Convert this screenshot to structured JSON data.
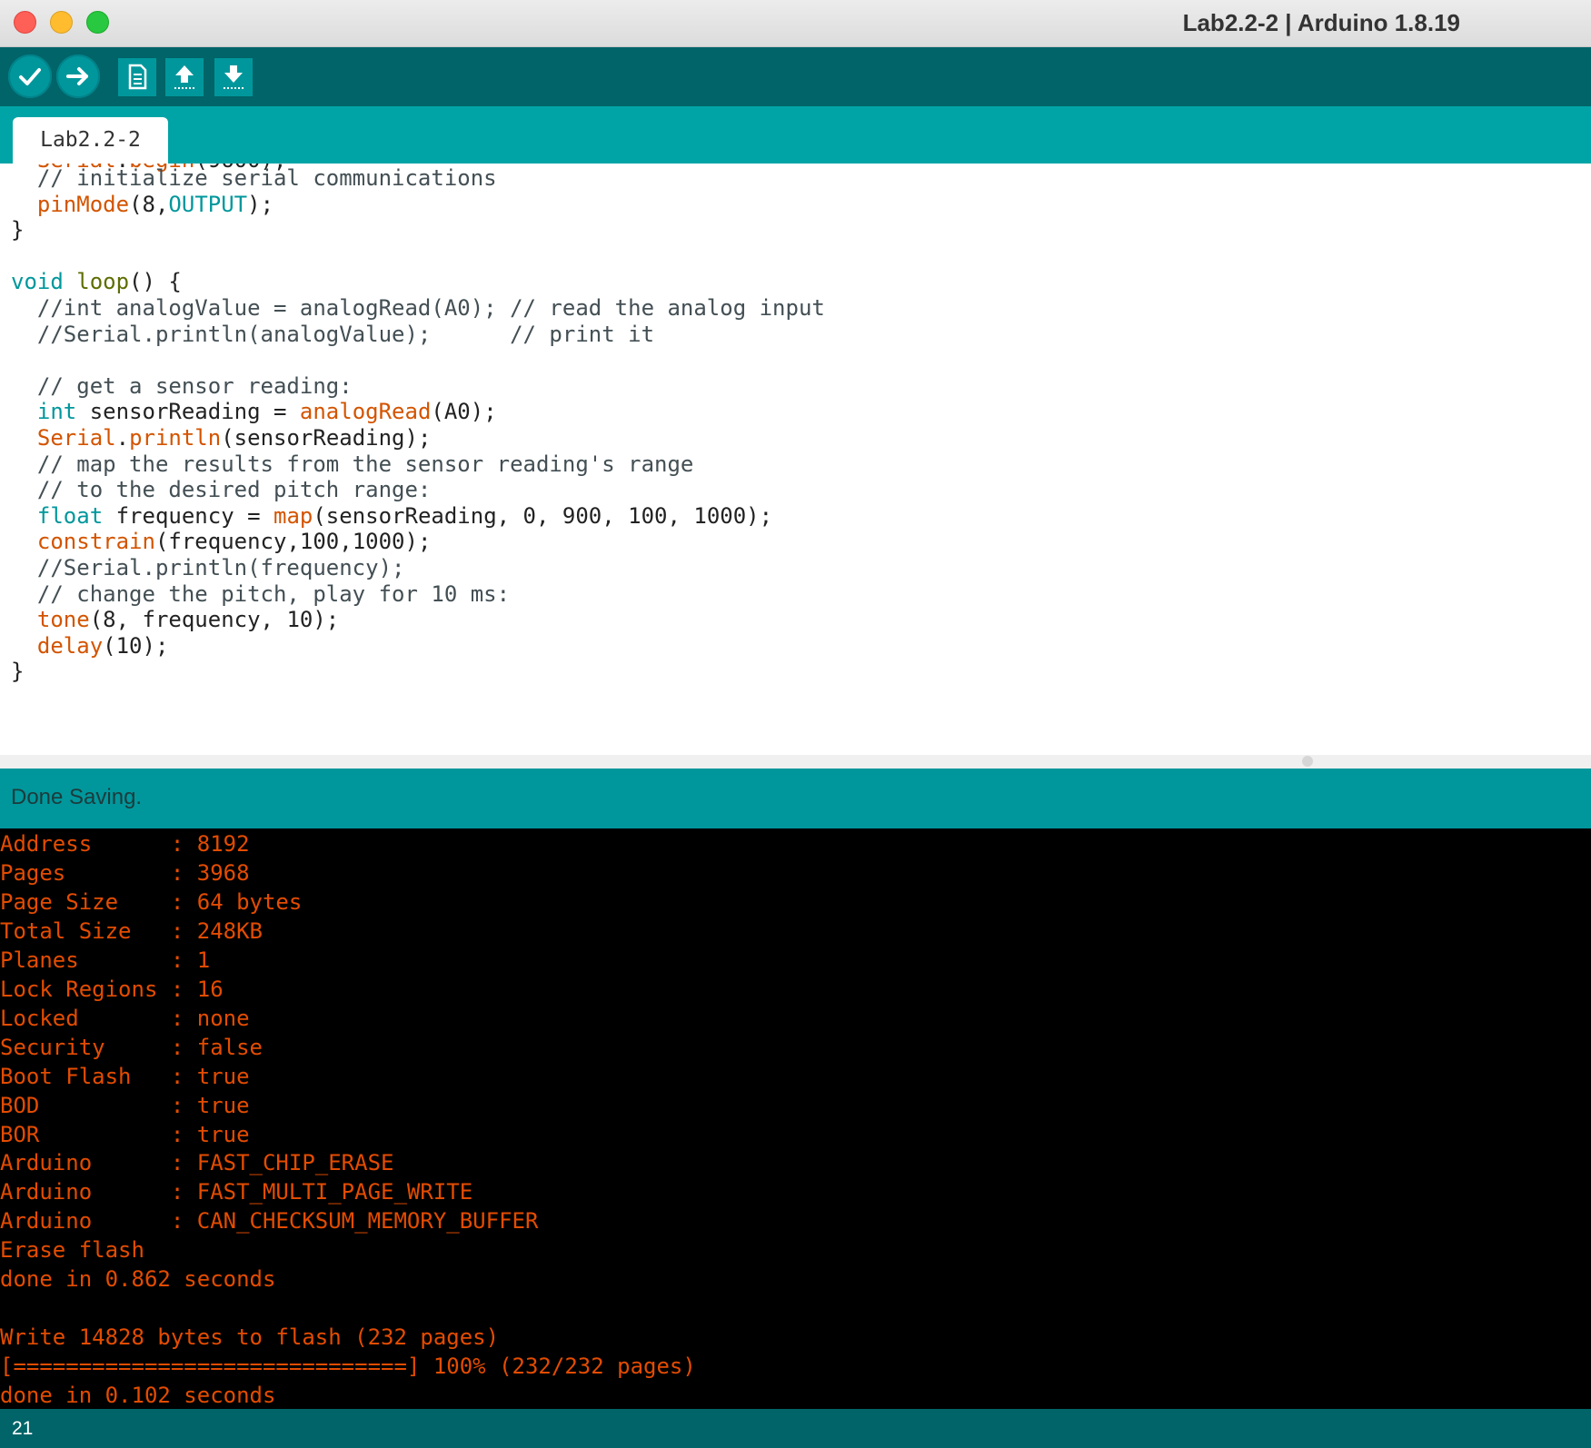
{
  "window": {
    "title": "Lab2.2-2 | Arduino 1.8.19"
  },
  "toolbar": {
    "buttons": [
      {
        "name": "verify",
        "icon": "checkmark-icon"
      },
      {
        "name": "upload",
        "icon": "arrow-right-icon"
      },
      {
        "name": "new",
        "icon": "new-file-icon"
      },
      {
        "name": "open",
        "icon": "arrow-up-icon"
      },
      {
        "name": "save",
        "icon": "arrow-down-icon"
      }
    ]
  },
  "tabs": [
    {
      "label": "Lab2.2-2"
    }
  ],
  "editor": {
    "lines": [
      {
        "parts": [
          {
            "t": "  // initialize serial communications",
            "c": "cm"
          }
        ]
      },
      {
        "parts": [
          {
            "t": "  "
          },
          {
            "t": "pinMode",
            "c": "fn"
          },
          {
            "t": "(8,"
          },
          {
            "t": "OUTPUT",
            "c": "kw"
          },
          {
            "t": ");"
          }
        ]
      },
      {
        "parts": [
          {
            "t": "}"
          }
        ]
      },
      {
        "parts": [
          {
            "t": ""
          }
        ]
      },
      {
        "parts": [
          {
            "t": "void",
            "c": "kw"
          },
          {
            "t": " "
          },
          {
            "t": "loop",
            "c": "lp"
          },
          {
            "t": "() {"
          }
        ]
      },
      {
        "parts": [
          {
            "t": "  //int analogValue = analogRead(A0); // read the analog input",
            "c": "cm"
          }
        ]
      },
      {
        "parts": [
          {
            "t": "  //Serial.println(analogValue);      // print it",
            "c": "cm"
          }
        ]
      },
      {
        "parts": [
          {
            "t": ""
          }
        ]
      },
      {
        "parts": [
          {
            "t": "  // get a sensor reading:",
            "c": "cm"
          }
        ]
      },
      {
        "parts": [
          {
            "t": "  "
          },
          {
            "t": "int",
            "c": "kw"
          },
          {
            "t": " sensorReading = "
          },
          {
            "t": "analogRead",
            "c": "fn"
          },
          {
            "t": "(A0);"
          }
        ]
      },
      {
        "parts": [
          {
            "t": "  "
          },
          {
            "t": "Serial",
            "c": "fn"
          },
          {
            "t": "."
          },
          {
            "t": "println",
            "c": "fn"
          },
          {
            "t": "(sensorReading);"
          }
        ]
      },
      {
        "parts": [
          {
            "t": "  // map the results from the sensor reading's range",
            "c": "cm"
          }
        ]
      },
      {
        "parts": [
          {
            "t": "  // to the desired pitch range:",
            "c": "cm"
          }
        ]
      },
      {
        "parts": [
          {
            "t": "  "
          },
          {
            "t": "float",
            "c": "kw"
          },
          {
            "t": " frequency = "
          },
          {
            "t": "map",
            "c": "fn"
          },
          {
            "t": "(sensorReading, 0, 900, 100, 1000);"
          }
        ]
      },
      {
        "parts": [
          {
            "t": "  "
          },
          {
            "t": "constrain",
            "c": "fn"
          },
          {
            "t": "(frequency,100,1000);"
          }
        ]
      },
      {
        "parts": [
          {
            "t": "  //Serial.println(frequency);",
            "c": "cm"
          }
        ]
      },
      {
        "parts": [
          {
            "t": "  // change the pitch, play for 10 ms:",
            "c": "cm"
          }
        ]
      },
      {
        "parts": [
          {
            "t": "  "
          },
          {
            "t": "tone",
            "c": "fn"
          },
          {
            "t": "(8, frequency, 10);"
          }
        ]
      },
      {
        "parts": [
          {
            "t": "  "
          },
          {
            "t": "delay",
            "c": "fn"
          },
          {
            "t": "(10);"
          }
        ]
      },
      {
        "parts": [
          {
            "t": "}"
          }
        ]
      }
    ]
  },
  "status": {
    "message": "Done Saving."
  },
  "console": {
    "lines": [
      "Address      : 8192",
      "Pages        : 3968",
      "Page Size    : 64 bytes",
      "Total Size   : 248KB",
      "Planes       : 1",
      "Lock Regions : 16",
      "Locked       : none",
      "Security     : false",
      "Boot Flash   : true",
      "BOD          : true",
      "BOR          : true",
      "Arduino      : FAST_CHIP_ERASE",
      "Arduino      : FAST_MULTI_PAGE_WRITE",
      "Arduino      : CAN_CHECKSUM_MEMORY_BUFFER",
      "Erase flash",
      "done in 0.862 seconds",
      "",
      "Write 14828 bytes to flash (232 pages)",
      "[==============================] 100% (232/232 pages)",
      "done in 0.102 seconds"
    ]
  },
  "footer": {
    "line_number": "21"
  },
  "colors": {
    "toolbar": "#006468",
    "tabstrip": "#00a4a7",
    "status": "#00979c",
    "keyword": "#00979c",
    "function": "#d35400",
    "console_text": "#e34c00"
  }
}
